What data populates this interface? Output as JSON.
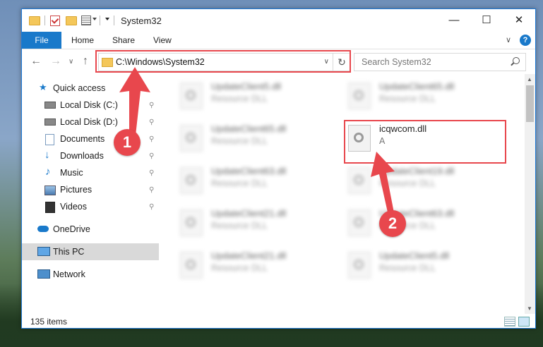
{
  "window": {
    "title": "System32",
    "accent_color": "#1979ca",
    "minimize_glyph": "—",
    "maximize_glyph": "☐",
    "close_glyph": "✕"
  },
  "ribbon": {
    "file_tab": "File",
    "tabs": [
      "Home",
      "Share",
      "View"
    ],
    "collapse_glyph": "∨",
    "help_glyph": "?"
  },
  "navigation": {
    "back_glyph": "←",
    "forward_glyph": "→",
    "recent_glyph": "∨",
    "up_glyph": "↑",
    "address_path": "C:\\Windows\\System32",
    "address_dropdown_glyph": "∨",
    "refresh_glyph": "↻",
    "search_placeholder": "Search System32"
  },
  "sidebar": {
    "items": [
      {
        "label": "Quick access",
        "icon": "star-icon",
        "pinned": false
      },
      {
        "label": "Local Disk (C:)",
        "icon": "drive-icon",
        "pinned": true
      },
      {
        "label": "Local Disk (D:)",
        "icon": "drive-icon",
        "pinned": true
      },
      {
        "label": "Documents",
        "icon": "documents-icon",
        "pinned": true
      },
      {
        "label": "Downloads",
        "icon": "download-icon",
        "pinned": true
      },
      {
        "label": "Music",
        "icon": "music-icon",
        "pinned": true
      },
      {
        "label": "Pictures",
        "icon": "pictures-icon",
        "pinned": true
      },
      {
        "label": "Videos",
        "icon": "videos-icon",
        "pinned": true
      },
      {
        "label": "OneDrive",
        "icon": "cloud-icon",
        "pinned": false
      },
      {
        "label": "This PC",
        "icon": "computer-icon",
        "pinned": false,
        "selected": true
      },
      {
        "label": "Network",
        "icon": "network-icon",
        "pinned": false
      }
    ],
    "pin_glyph": "📌"
  },
  "files": [
    {
      "name": "UpdateClient5.dll",
      "desc": "Resource DLL",
      "blurred": true
    },
    {
      "name": "UpdateClient65.dll",
      "desc": "Resource DLL",
      "blurred": true
    },
    {
      "name": "UpdateClient65.dll",
      "desc": "Resource DLL",
      "blurred": true
    },
    {
      "name": "icqwcom.dll",
      "desc": "A",
      "blurred": false
    },
    {
      "name": "UpdateClient63.dll",
      "desc": "Resource DLL",
      "blurred": true
    },
    {
      "name": "UpdateClient19.dll",
      "desc": "Resource DLL",
      "blurred": true
    },
    {
      "name": "UpdateClient21.dll",
      "desc": "Resource DLL",
      "blurred": true
    },
    {
      "name": "UpdateClient63.dll",
      "desc": "Resource DLL",
      "blurred": true
    },
    {
      "name": "UpdateClient21.dll",
      "desc": "Resource DLL",
      "blurred": true
    },
    {
      "name": "UpdateClient5.dll",
      "desc": "Resource DLL",
      "blurred": true
    }
  ],
  "status": {
    "item_count": "135 items"
  },
  "annotations": {
    "badge_1": "1",
    "badge_2": "2",
    "color": "#e8474d"
  }
}
